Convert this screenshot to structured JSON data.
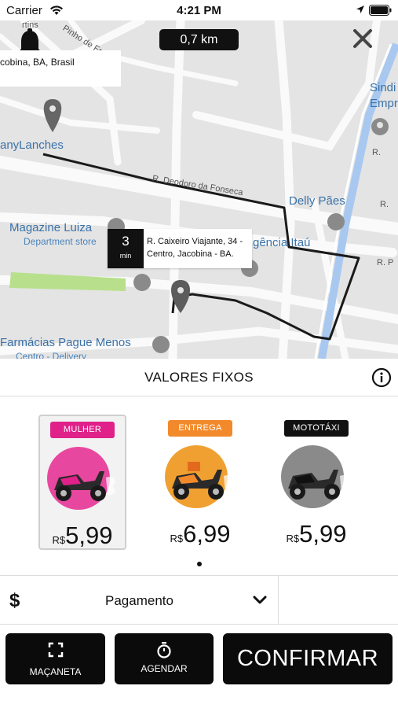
{
  "status_bar": {
    "carrier": "Carrier",
    "time": "4:21 PM"
  },
  "map": {
    "distance": "0,7 km",
    "address_banner": "cobina, BA, Brasil",
    "places": {
      "lanches": "anyLanches",
      "magazine": "Magazine Luiza",
      "magazine_sub": "Department store",
      "delly": "Delly Pães",
      "agencia": "gência Itaú",
      "farmacias": "Farmácias Pague Menos",
      "farmacias_sub": "Centro - Delivery",
      "sindi": "Sindi",
      "empr": "Empr",
      "pinho": "Pinho de Fre",
      "rtins": "rtins"
    },
    "streets": {
      "deodoro": "R. Deodoro da Fonseca",
      "r1": "R.",
      "r2": "R.",
      "rp": "R. P"
    },
    "eta": {
      "minutes": "3",
      "unit": "min",
      "address_line1": "R. Caixeiro Viajante, 34 -",
      "address_line2": "Centro, Jacobina - BA."
    }
  },
  "fixed_values": {
    "title": "VALORES FIXOS"
  },
  "options": [
    {
      "tag": "MULHER",
      "currency": "R$",
      "price": "5,99",
      "tag_color": "#e0218a",
      "bike_color": "#e8479f",
      "selected": true
    },
    {
      "tag": "ENTREGA",
      "currency": "R$",
      "price": "6,99",
      "tag_color": "#f28a2c",
      "bike_color": "#f0a030",
      "selected": false
    },
    {
      "tag": "MOTOTÁXI",
      "currency": "R$",
      "price": "5,99",
      "tag_color": "#111111",
      "bike_color": "#8a8a8a",
      "selected": false
    }
  ],
  "payment": {
    "icon": "$",
    "label": "Pagamento"
  },
  "buttons": {
    "macaneta": "MAÇANETA",
    "agendar": "AGENDAR",
    "confirmar": "CONFIRMAR"
  },
  "icons": [
    "wifi-icon",
    "location-arrow-icon",
    "battery-icon",
    "bell-icon",
    "close-icon",
    "map-pin-icon",
    "info-icon",
    "chevron-down-icon",
    "expand-icon",
    "stopwatch-icon",
    "motorcycle-icon"
  ]
}
